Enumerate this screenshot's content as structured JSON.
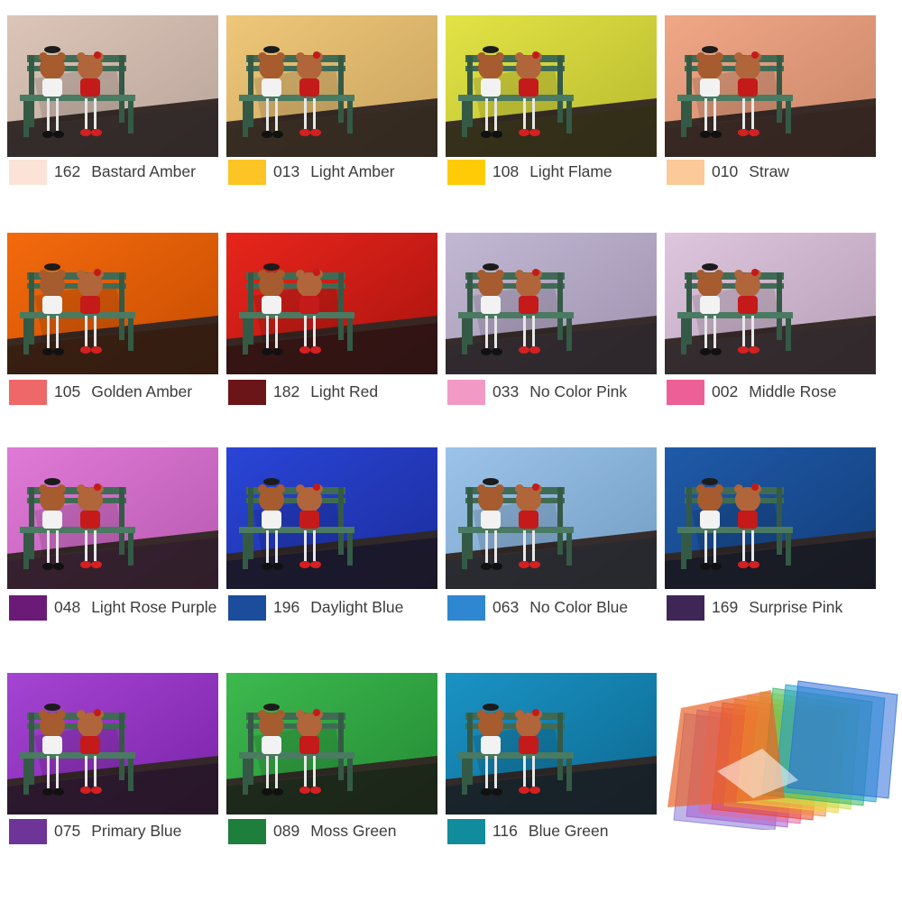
{
  "filters": [
    {
      "code": "162",
      "name": "Bastard Amber",
      "swatch": "#fbe3d8",
      "bg": "#dcc5b8",
      "bg2": "#b9a49a"
    },
    {
      "code": "013",
      "name": "Light Amber",
      "swatch": "#fcc424",
      "bg": "#eec779",
      "bg2": "#c9a35e"
    },
    {
      "code": "108",
      "name": "Light Flame",
      "swatch": "#fecb06",
      "bg": "#e2e345",
      "bg2": "#b8b92e"
    },
    {
      "code": "010",
      "name": "Straw",
      "swatch": "#fbca98",
      "bg": "#f0a786",
      "bg2": "#c98669"
    },
    {
      "code": "105",
      "name": "Golden Amber",
      "swatch": "#ef6869",
      "bg": "#f46a0d",
      "bg2": "#c54c00"
    },
    {
      "code": "182",
      "name": "Light Red",
      "swatch": "#6c1518",
      "bg": "#e8251c",
      "bg2": "#a8130e"
    },
    {
      "code": "033",
      "name": "No Color Pink",
      "swatch": "#f29ac5",
      "bg": "#c3b8d4",
      "bg2": "#9d91ae"
    },
    {
      "code": "002",
      "name": "Middle Rose",
      "swatch": "#ed6097",
      "bg": "#dec6de",
      "bg2": "#b59eb5"
    },
    {
      "code": "048",
      "name": "Light Rose Purple",
      "swatch": "#6b1a78",
      "bg": "#e07ad8",
      "bg2": "#b659ae"
    },
    {
      "code": "196",
      "name": "Daylight Blue",
      "swatch": "#1b4d9c",
      "bg": "#2a45d8",
      "bg2": "#1a2c9a"
    },
    {
      "code": "063",
      "name": "No Color Blue",
      "swatch": "#2e87d0",
      "bg": "#9cc4ea",
      "bg2": "#739cc3"
    },
    {
      "code": "169",
      "name": "Surprise Pink",
      "swatch": "#3e2656",
      "bg": "#1f5aa8",
      "bg2": "#123d7a"
    },
    {
      "code": "075",
      "name": "Primary Blue",
      "swatch": "#6e3497",
      "bg": "#a544d3",
      "bg2": "#7a23a8"
    },
    {
      "code": "089",
      "name": "Moss Green",
      "swatch": "#1e7f3d",
      "bg": "#3db94e",
      "bg2": "#238a34"
    },
    {
      "code": "116",
      "name": "Blue Green",
      "swatch": "#108c9c",
      "bg": "#1a93c4",
      "bg2": "#0d6890"
    }
  ],
  "stack_colors": [
    "#2f6fd8",
    "#1e9fd0",
    "#3bb863",
    "#c6e04a",
    "#f0d23a",
    "#f08a3a",
    "#e8462c",
    "#e06aa8",
    "#a65bd0",
    "#8a7ad6"
  ]
}
